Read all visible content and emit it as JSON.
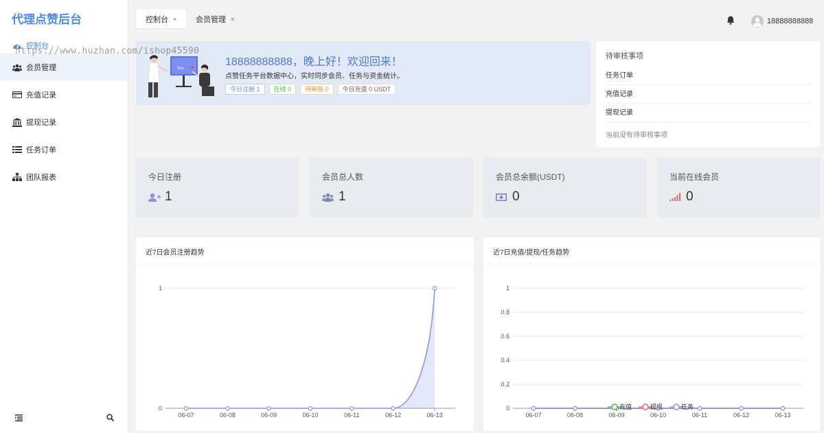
{
  "brand": "代理点赞后台",
  "watermark": "https://www.huzhan.com/ishop45590",
  "sidebar": {
    "items": [
      {
        "label": "控制台",
        "icon": "dashboard-icon"
      },
      {
        "label": "会员管理",
        "icon": "users-icon"
      },
      {
        "label": "充值记录",
        "icon": "credit-card-icon"
      },
      {
        "label": "提现记录",
        "icon": "bank-icon"
      },
      {
        "label": "任务订单",
        "icon": "task-list-icon"
      },
      {
        "label": "团队报表",
        "icon": "sitemap-icon"
      }
    ],
    "footer_icons": [
      "menu-toggle-icon",
      "search-icon"
    ]
  },
  "tabs": [
    {
      "label": "控制台",
      "close": "×"
    },
    {
      "label": "会员管理",
      "close": "×"
    }
  ],
  "header": {
    "username": "18888888888",
    "icons": [
      "bell-icon",
      "avatar"
    ]
  },
  "welcome": {
    "greeting": "18888888888，晚上好！欢迎回来！",
    "subtitle": "点赞任务平台数据中心，实时同步会员、任务与资金统计。",
    "illustration_text": "Text...",
    "tags": [
      {
        "label": "今日注册 1",
        "color": "#5b8fe0"
      },
      {
        "label": "在线 0",
        "color": "#52b846"
      },
      {
        "label": "待审核 0",
        "color": "#e6913c"
      },
      {
        "label": "今日充值 0 USDT",
        "color": "#666666"
      }
    ]
  },
  "pending": {
    "title": "待审核事项",
    "items": [
      "任务订单",
      "充值记录",
      "提现记录"
    ],
    "empty_text": "当前没有待审核事项"
  },
  "stats": [
    {
      "label": "今日注册",
      "value": "1",
      "icon": "user-plus-icon",
      "icon_color": "#8a8fe0"
    },
    {
      "label": "会员总人数",
      "value": "1",
      "icon": "users-icon",
      "icon_color": "#7a8aa8"
    },
    {
      "label": "会员总余额(USDT)",
      "value": "0",
      "icon": "money-bill-icon",
      "icon_color": "#8b7ad0"
    },
    {
      "label": "当前在线会员",
      "value": "0",
      "icon": "signal-bars-icon",
      "icon_color": "#e56d6d"
    }
  ],
  "chart_data": [
    {
      "type": "area",
      "title": "近7日会员注册趋势",
      "categories": [
        "06-07",
        "06-08",
        "06-09",
        "06-10",
        "06-11",
        "06-12",
        "06-13"
      ],
      "series": [
        {
          "values": [
            0,
            0,
            0,
            0,
            0,
            0,
            1
          ],
          "color": "#8a95e6"
        }
      ],
      "ylim": [
        0,
        1
      ],
      "yticks": [
        "0",
        "1"
      ],
      "grid": true
    },
    {
      "type": "line",
      "title": "近7日充值/提现/任务趋势",
      "categories": [
        "06-07",
        "06-08",
        "06-09",
        "06-10",
        "06-11",
        "06-12",
        "06-13"
      ],
      "series": [
        {
          "name": "充值",
          "values": [
            0,
            0,
            0,
            0,
            0,
            0,
            0
          ],
          "color": "#52b846"
        },
        {
          "name": "提现",
          "values": [
            0,
            0,
            0,
            0,
            0,
            0,
            0
          ],
          "color": "#e56d6d"
        },
        {
          "name": "任务",
          "values": [
            0,
            0,
            0,
            0,
            0,
            0,
            0
          ],
          "color": "#8a95e6"
        }
      ],
      "ylim": [
        0,
        1
      ],
      "yticks": [
        "0",
        "0.2",
        "0.4",
        "0.6",
        "0.8",
        "1"
      ],
      "legend": "bottom-center",
      "grid": true
    }
  ]
}
